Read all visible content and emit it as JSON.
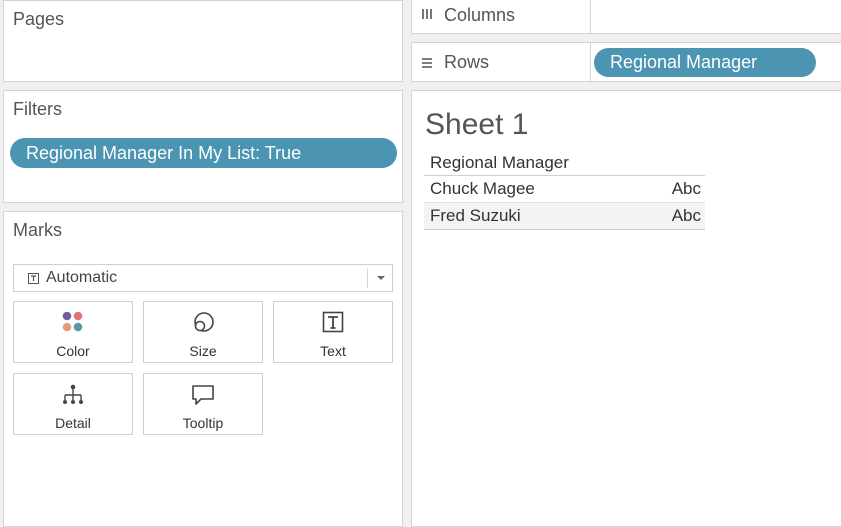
{
  "pages": {
    "title": "Pages"
  },
  "filters": {
    "title": "Filters",
    "items": [
      {
        "label": "Regional Manager In My List: True"
      }
    ]
  },
  "marks": {
    "title": "Marks",
    "mark_type": "Automatic",
    "mark_type_icon": "text-icon",
    "buttons": [
      {
        "label": "Color",
        "icon": "color-icon"
      },
      {
        "label": "Size",
        "icon": "size-icon"
      },
      {
        "label": "Text",
        "icon": "text-icon"
      },
      {
        "label": "Detail",
        "icon": "detail-icon"
      },
      {
        "label": "Tooltip",
        "icon": "tooltip-icon"
      }
    ]
  },
  "shelves": {
    "columns": {
      "label": "Columns",
      "icon": "columns-icon",
      "pills": []
    },
    "rows": {
      "label": "Rows",
      "icon": "rows-icon",
      "pills": [
        {
          "label": "Regional Manager"
        }
      ]
    }
  },
  "sheet": {
    "title": "Sheet 1",
    "table": {
      "header": "Regional Manager",
      "rows": [
        {
          "name": "Chuck Magee",
          "value": "Abc"
        },
        {
          "name": "Fred Suzuki",
          "value": "Abc"
        }
      ]
    }
  },
  "colors": {
    "pill": "#4b95b2",
    "color_dots": [
      "#6f5fa0",
      "#e8707b",
      "#e89a70",
      "#5b96a8"
    ]
  }
}
